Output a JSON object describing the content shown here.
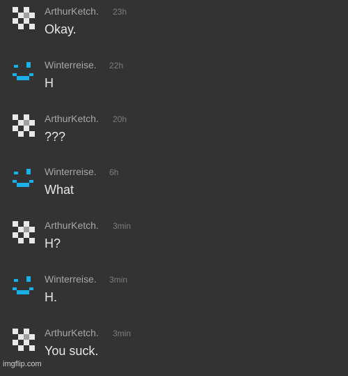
{
  "messages": [
    {
      "author": "ArthurKetch.",
      "time": "23h",
      "text": "Okay.",
      "avatar_icon": "pixel-cross-avatar-icon"
    },
    {
      "author": "Winterreise.",
      "time": "22h",
      "text": "H",
      "avatar_icon": "pixel-smiley-avatar-icon"
    },
    {
      "author": "ArthurKetch.",
      "time": "20h",
      "text": "???",
      "avatar_icon": "pixel-cross-avatar-icon"
    },
    {
      "author": "Winterreise.",
      "time": "6h",
      "text": "What",
      "avatar_icon": "pixel-smiley-avatar-icon"
    },
    {
      "author": "ArthurKetch.",
      "time": "3min",
      "text": "H?",
      "avatar_icon": "pixel-cross-avatar-icon"
    },
    {
      "author": "Winterreise.",
      "time": "3min",
      "text": "H.",
      "avatar_icon": "pixel-smiley-avatar-icon"
    },
    {
      "author": "ArthurKetch.",
      "time": "3min",
      "text": "You suck.",
      "avatar_icon": "pixel-cross-avatar-icon"
    }
  ],
  "watermark": "imgflip.com",
  "colors": {
    "background": "#333333",
    "author": "#a8a8a8",
    "time": "#7d7d7d",
    "text": "#e6e6e6",
    "smiley_avatar": "#1ab0e8",
    "cross_avatar": "#e8e8e8"
  }
}
